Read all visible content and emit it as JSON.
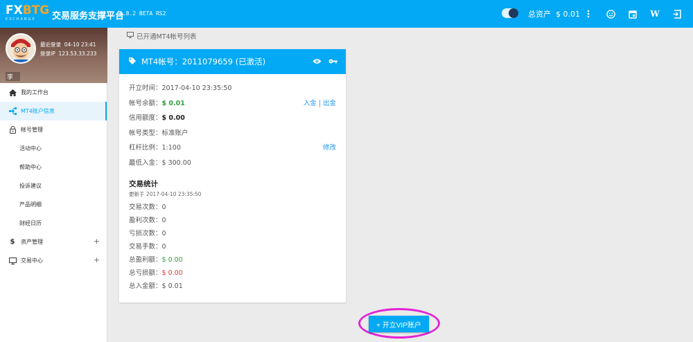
{
  "app": {
    "logo_main_a": "FX",
    "logo_main_b": "BTG",
    "logo_sub": "EXCHANGE",
    "title": "交易服务支撑平台",
    "version": "0.8.2 BETA RS2"
  },
  "topbar": {
    "total_assets_label": "总资产",
    "total_assets_value": "$ 0.01",
    "icons": [
      "toggle-switch",
      "more-vert-icon",
      "smiley-icon",
      "calendar-icon",
      "wordpress-icon",
      "logout-icon"
    ]
  },
  "profile": {
    "last_login_label": "最近登录",
    "last_login_value": "04-10 23:41",
    "ip_label": "登录IP",
    "ip_value": "123.53.33.233",
    "username": "李"
  },
  "sidebar": {
    "items": [
      {
        "label": "我的工作台",
        "icon": "home-icon"
      },
      {
        "label": "MT4账户信息",
        "icon": "account-tree-icon",
        "active": true
      },
      {
        "label": "帐号管理",
        "icon": "lock-icon"
      },
      {
        "label": "活动中心",
        "sub": true
      },
      {
        "label": "帮助中心",
        "sub": true
      },
      {
        "label": "投诉建议",
        "sub": true
      },
      {
        "label": "产品明细",
        "sub": true
      },
      {
        "label": "财经日历",
        "sub": true
      },
      {
        "label": "资产管理",
        "icon": "dollar-icon",
        "expand": "+"
      },
      {
        "label": "交易中心",
        "icon": "monitor-icon",
        "expand": "+"
      }
    ]
  },
  "breadcrumb": "已开通MT4帐号列表",
  "card": {
    "header": "MT4帐号：2011079659 (已激活)",
    "rows": [
      {
        "label": "开立时间：",
        "value": "2017-04-10 23:35:50"
      },
      {
        "label": "帐号余额：",
        "value": "$ 0.01",
        "action1": "入金",
        "sep": "|",
        "action2": "出金"
      },
      {
        "label": "信用额度：",
        "value": "$ 0.00"
      },
      {
        "label": "帐号类型：",
        "value": "标准账户"
      },
      {
        "label": "杠杆比例：",
        "value": "1:100",
        "action1": "修改"
      },
      {
        "label": "最低入金：",
        "value": "$ 300.00"
      }
    ],
    "stats_title": "交易统计",
    "stats_updated": "更新于 2017-04-10 23:35:50",
    "stats": [
      {
        "label": "交易次数：",
        "value": "0"
      },
      {
        "label": "盈利次数：",
        "value": "0"
      },
      {
        "label": "亏损次数：",
        "value": "0"
      },
      {
        "label": "交易手数：",
        "value": "0"
      },
      {
        "label": "总盈利额：",
        "value": "$ 0.00"
      },
      {
        "label": "总亏损额：",
        "value": "$ 0.00"
      },
      {
        "label": "总入金额：",
        "value": "$ 0.01"
      }
    ]
  },
  "vip_button": "+ 开立VIP账户",
  "colors": {
    "primary": "#03a9f4",
    "highlight_ring": "#e025d6",
    "profit": "#3ca23c",
    "loss": "#e53935"
  }
}
